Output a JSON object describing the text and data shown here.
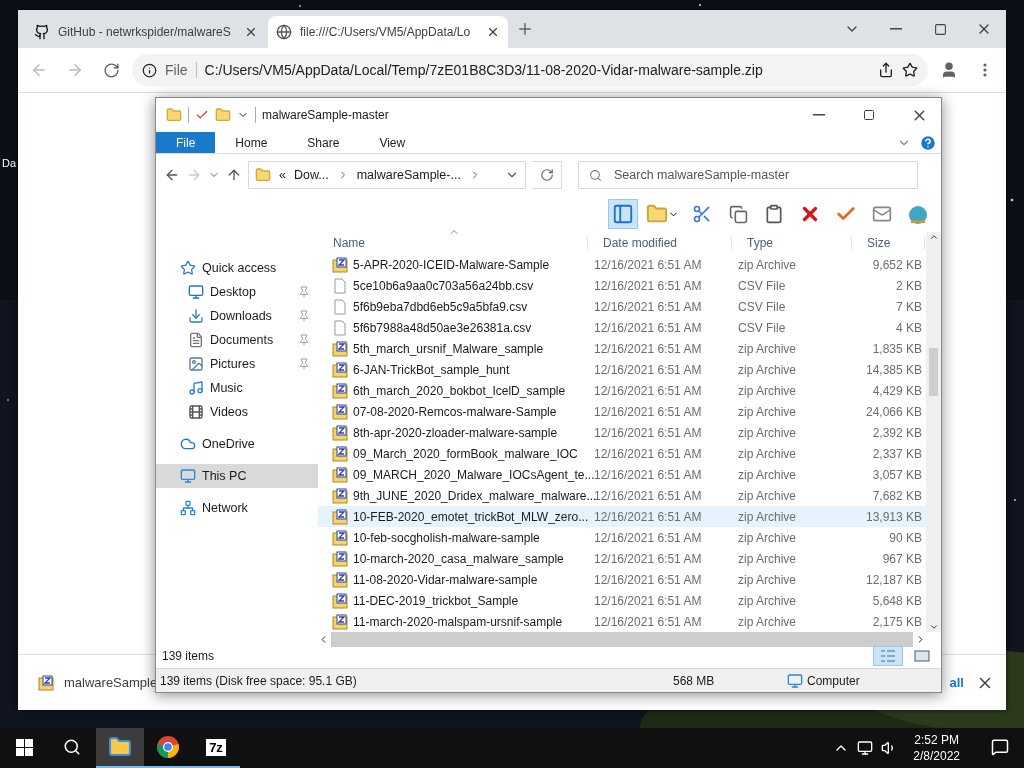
{
  "desktop": {
    "icon_label": "Da"
  },
  "browser": {
    "tabs": [
      {
        "title": "GitHub - netwrkspider/malwareS",
        "selected": false
      },
      {
        "title": "file:///C:/Users/VM5/AppData/Lo",
        "selected": true
      }
    ],
    "address": {
      "scheme": "File",
      "url": "C:/Users/VM5/AppData/Local/Temp/7zE01B8C3D3/11-08-2020-Vidar-malware-sample.zip"
    },
    "download_bar": {
      "item": "malwareSample",
      "show_all": "all"
    }
  },
  "explorer": {
    "title": "malwareSample-master",
    "ribbon_tabs": [
      {
        "label": "File",
        "selected": true
      },
      {
        "label": "Home",
        "selected": false
      },
      {
        "label": "Share",
        "selected": false
      },
      {
        "label": "View",
        "selected": false
      }
    ],
    "breadcrumb_overflow": "«",
    "breadcrumb": [
      "Dow...",
      "malwareSample-..."
    ],
    "search": {
      "placeholder": "Search malwareSample-master"
    },
    "nav": [
      {
        "label": "Quick access",
        "kind": "star",
        "selected": false,
        "children": [
          {
            "label": "Desktop",
            "kind": "desktop",
            "pinned": true,
            "selected": false
          },
          {
            "label": "Downloads",
            "kind": "download",
            "pinned": true,
            "selected": false
          },
          {
            "label": "Documents",
            "kind": "document",
            "pinned": true,
            "selected": false
          },
          {
            "label": "Pictures",
            "kind": "picture",
            "pinned": true,
            "selected": false
          },
          {
            "label": "Music",
            "kind": "music",
            "pinned": false,
            "selected": false
          },
          {
            "label": "Videos",
            "kind": "video",
            "pinned": false,
            "selected": false
          }
        ]
      },
      {
        "label": "OneDrive",
        "kind": "cloud",
        "selected": false
      },
      {
        "label": "This PC",
        "kind": "pc",
        "selected": true
      },
      {
        "label": "Network",
        "kind": "network",
        "selected": false
      }
    ],
    "columns": [
      "Name",
      "Date modified",
      "Type",
      "Size"
    ],
    "rows": [
      {
        "name": "5-APR-2020-ICEID-Malware-Sample",
        "date": "12/16/2021 6:51 AM",
        "type": "zip Archive",
        "size": "9,652 KB",
        "kind": "zip",
        "selected": false
      },
      {
        "name": "5ce10b6a9aa0c703a56a24bb.csv",
        "date": "12/16/2021 6:51 AM",
        "type": "CSV File",
        "size": "2 KB",
        "kind": "csv",
        "selected": false
      },
      {
        "name": "5f6b9eba7dbd6eb5c9a5bfa9.csv",
        "date": "12/16/2021 6:51 AM",
        "type": "CSV File",
        "size": "7 KB",
        "kind": "csv",
        "selected": false
      },
      {
        "name": "5f6b7988a48d50ae3e26381a.csv",
        "date": "12/16/2021 6:51 AM",
        "type": "CSV File",
        "size": "4 KB",
        "kind": "csv",
        "selected": false
      },
      {
        "name": "5th_march_ursnif_Malware_sample",
        "date": "12/16/2021 6:51 AM",
        "type": "zip Archive",
        "size": "1,835 KB",
        "kind": "zip",
        "selected": false
      },
      {
        "name": "6-JAN-TrickBot_sample_hunt",
        "date": "12/16/2021 6:51 AM",
        "type": "zip Archive",
        "size": "14,385 KB",
        "kind": "zip",
        "selected": false
      },
      {
        "name": "6th_march_2020_bokbot_IcelD_sample",
        "date": "12/16/2021 6:51 AM",
        "type": "zip Archive",
        "size": "4,429 KB",
        "kind": "zip",
        "selected": false
      },
      {
        "name": "07-08-2020-Remcos-malware-Sample",
        "date": "12/16/2021 6:51 AM",
        "type": "zip Archive",
        "size": "24,066 KB",
        "kind": "zip",
        "selected": false
      },
      {
        "name": "8th-apr-2020-zloader-malware-sample",
        "date": "12/16/2021 6:51 AM",
        "type": "zip Archive",
        "size": "2,392 KB",
        "kind": "zip",
        "selected": false
      },
      {
        "name": "09_March_2020_formBook_malware_IOC",
        "date": "12/16/2021 6:51 AM",
        "type": "zip Archive",
        "size": "2,337 KB",
        "kind": "zip",
        "selected": false
      },
      {
        "name": "09_MARCH_2020_Malware_IOCsAgent_te...",
        "date": "12/16/2021 6:51 AM",
        "type": "zip Archive",
        "size": "3,057 KB",
        "kind": "zip",
        "selected": false
      },
      {
        "name": "9th_JUNE_2020_Dridex_malware_malware...",
        "date": "12/16/2021 6:51 AM",
        "type": "zip Archive",
        "size": "7,682 KB",
        "kind": "zip",
        "selected": false
      },
      {
        "name": "10-FEB-2020_emotet_trickBot_MLW_zero...",
        "date": "12/16/2021 6:51 AM",
        "type": "zip Archive",
        "size": "13,913 KB",
        "kind": "zip",
        "selected": true
      },
      {
        "name": "10-feb-socgholish-malware-sample",
        "date": "12/16/2021 6:51 AM",
        "type": "zip Archive",
        "size": "90 KB",
        "kind": "zip",
        "selected": false
      },
      {
        "name": "10-march-2020_casa_malware_sample",
        "date": "12/16/2021 6:51 AM",
        "type": "zip Archive",
        "size": "967 KB",
        "kind": "zip",
        "selected": false
      },
      {
        "name": "11-08-2020-Vidar-malware-sample",
        "date": "12/16/2021 6:51 AM",
        "type": "zip Archive",
        "size": "12,187 KB",
        "kind": "zip",
        "selected": false
      },
      {
        "name": "11-DEC-2019_trickbot_Sample",
        "date": "12/16/2021 6:51 AM",
        "type": "zip Archive",
        "size": "5,648 KB",
        "kind": "zip",
        "selected": false
      },
      {
        "name": "11-march-2020-malspam-ursnif-sample",
        "date": "12/16/2021 6:51 AM",
        "type": "zip Archive",
        "size": "2,175 KB",
        "kind": "zip",
        "selected": false
      }
    ],
    "item_count": "139 items",
    "status": {
      "summary": "139 items (Disk free space: 95.1 GB)",
      "size": "568 MB",
      "location": "Computer"
    }
  },
  "taskbar": {
    "apps": [
      {
        "kind": "explorer",
        "active": true
      },
      {
        "kind": "chrome",
        "active": false
      },
      {
        "kind": "sevenzip",
        "label": "7z",
        "active": false
      }
    ],
    "time": "2:52 PM",
    "date": "2/8/2022"
  }
}
